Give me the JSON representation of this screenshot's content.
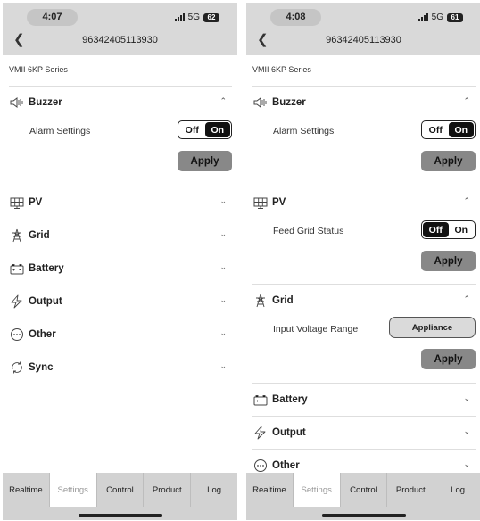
{
  "screens": [
    {
      "time": "4:07",
      "network": "5G",
      "battery": "62",
      "device_id": "96342405113930",
      "series": "VMII 6KP Series",
      "sections": {
        "buzzer": {
          "title": "Buzzer",
          "expanded": true,
          "row_label": "Alarm Settings",
          "toggle": {
            "off": "Off",
            "on": "On",
            "selected": "On"
          },
          "apply": "Apply"
        },
        "pv": {
          "title": "PV"
        },
        "grid": {
          "title": "Grid"
        },
        "battery": {
          "title": "Battery"
        },
        "output": {
          "title": "Output"
        },
        "other": {
          "title": "Other"
        },
        "sync": {
          "title": "Sync"
        }
      },
      "tabs": [
        "Realtime",
        "Settings",
        "Control",
        "Product",
        "Log"
      ],
      "active_tab": "Settings"
    },
    {
      "time": "4:08",
      "network": "5G",
      "battery": "61",
      "device_id": "96342405113930",
      "series": "VMII 6KP Series",
      "sections": {
        "buzzer": {
          "title": "Buzzer",
          "expanded": true,
          "row_label": "Alarm Settings",
          "toggle": {
            "off": "Off",
            "on": "On",
            "selected": "On"
          },
          "apply": "Apply"
        },
        "pv": {
          "title": "PV",
          "expanded": true,
          "row_label": "Feed Grid Status",
          "toggle": {
            "off": "Off",
            "on": "On",
            "selected": "Off"
          },
          "apply": "Apply"
        },
        "grid": {
          "title": "Grid",
          "expanded": true,
          "row_label": "Input Voltage Range",
          "select_value": "Appliance",
          "apply": "Apply"
        },
        "battery": {
          "title": "Battery"
        },
        "output": {
          "title": "Output"
        },
        "other": {
          "title": "Other"
        }
      },
      "tabs": [
        "Realtime",
        "Settings",
        "Control",
        "Product",
        "Log"
      ],
      "active_tab": "Settings"
    }
  ],
  "colors": {
    "header_bg": "#d9d9d9",
    "tabbar_bg": "#d2d2d2",
    "apply_bg": "#888888",
    "toggle_selected": "#111111"
  },
  "icons": {
    "buzzer": "speaker-icon",
    "pv": "solar-panel-icon",
    "grid": "transmission-tower-icon",
    "battery": "battery-icon",
    "output": "lightning-icon",
    "other": "more-dots-icon",
    "sync": "sync-icon"
  }
}
